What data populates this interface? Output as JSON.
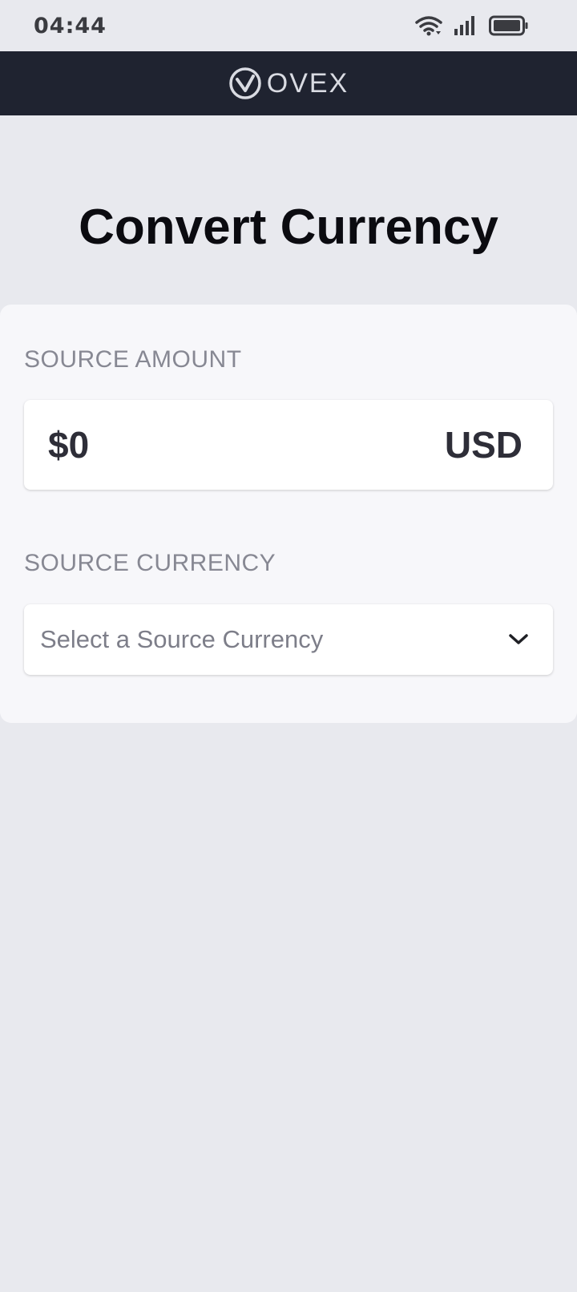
{
  "status_bar": {
    "time": "04:44",
    "icons": [
      "wifi-icon",
      "signal-icon",
      "battery-icon"
    ]
  },
  "header": {
    "logo_text": "OVEX",
    "logo_icon": "ovex-logo-icon"
  },
  "page": {
    "title": "Convert Currency"
  },
  "form": {
    "source_amount": {
      "label": "SOURCE AMOUNT",
      "value": "$0",
      "currency": "USD"
    },
    "source_currency": {
      "label": "SOURCE CURRENCY",
      "placeholder": "Select a Source Currency",
      "icon": "chevron-down-icon"
    }
  },
  "colors": {
    "background": "#e8e9ee",
    "header": "#1f2330",
    "card": "#f7f7fa",
    "title": "#0b0b10",
    "label": "#878893"
  }
}
